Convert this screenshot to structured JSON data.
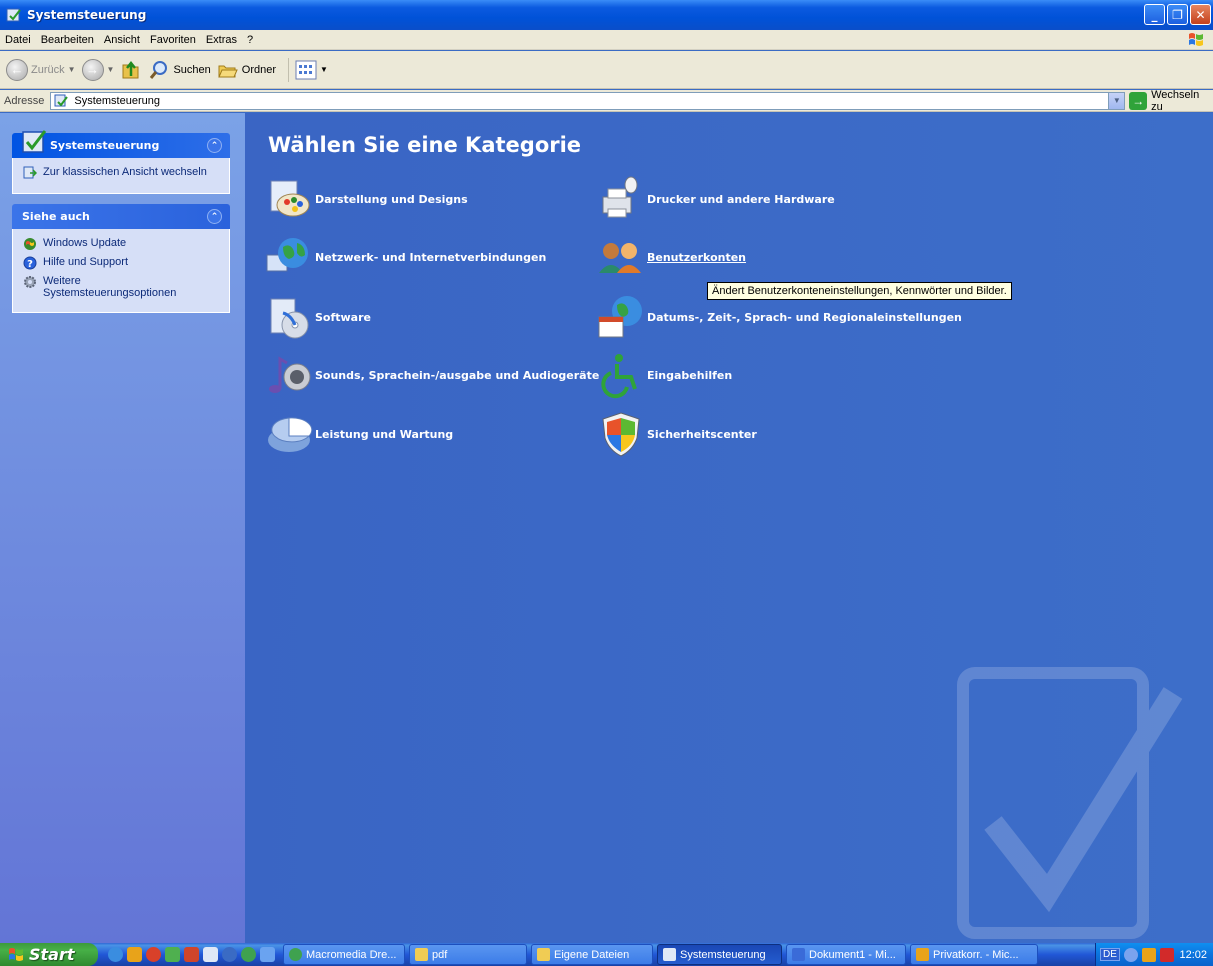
{
  "window": {
    "title": "Systemsteuerung"
  },
  "menu": [
    "Datei",
    "Bearbeiten",
    "Ansicht",
    "Favoriten",
    "Extras",
    "?"
  ],
  "toolbar": {
    "back_label": "Zurück",
    "search_label": "Suchen",
    "folders_label": "Ordner"
  },
  "address": {
    "label": "Adresse",
    "value": "Systemsteuerung",
    "go_label": "Wechseln zu"
  },
  "sidebar": {
    "panel1": {
      "title": "Systemsteuerung",
      "items": [
        "Zur klassischen Ansicht wechseln"
      ]
    },
    "panel2": {
      "title": "Siehe auch",
      "items": [
        "Windows Update",
        "Hilfe und Support",
        "Weitere Systemsteuerungsoptionen"
      ]
    }
  },
  "main": {
    "heading": "Wählen Sie eine Kategorie",
    "categories_left": [
      {
        "label": "Darstellung und Designs",
        "icon": "appearance-icon"
      },
      {
        "label": "Netzwerk- und Internetverbindungen",
        "icon": "network-icon"
      },
      {
        "label": "Software",
        "icon": "software-icon"
      },
      {
        "label": "Sounds, Sprachein-/ausgabe und Audiogeräte",
        "icon": "sounds-icon"
      },
      {
        "label": "Leistung und Wartung",
        "icon": "performance-icon"
      }
    ],
    "categories_right": [
      {
        "label": "Drucker und andere Hardware",
        "icon": "printer-icon"
      },
      {
        "label": "Benutzerkonten",
        "icon": "user-accounts-icon"
      },
      {
        "label": "Datums-, Zeit-, Sprach- und Regionaleinstellungen",
        "icon": "date-time-icon"
      },
      {
        "label": "Eingabehilfen",
        "icon": "accessibility-icon"
      },
      {
        "label": "Sicherheitscenter",
        "icon": "security-center-icon"
      }
    ],
    "tooltip": "Ändert Benutzerkonteneinstellungen, Kennwörter und Bilder."
  },
  "taskbar": {
    "start_label": "Start",
    "buttons": [
      "Macromedia Dre...",
      "pdf",
      "Eigene Dateien",
      "Systemsteuerung",
      "Dokument1 - Mi...",
      "Privatkorr. - Mic..."
    ],
    "active_index": 3,
    "language": "DE",
    "clock": "12:02"
  },
  "colors": {
    "main_bg": "#3d6ec9",
    "sidebar_bg": "#7ba2e7",
    "titlebar": "#0052d8",
    "taskbar": "#2157d7",
    "start_green": "#3c9a3c"
  }
}
